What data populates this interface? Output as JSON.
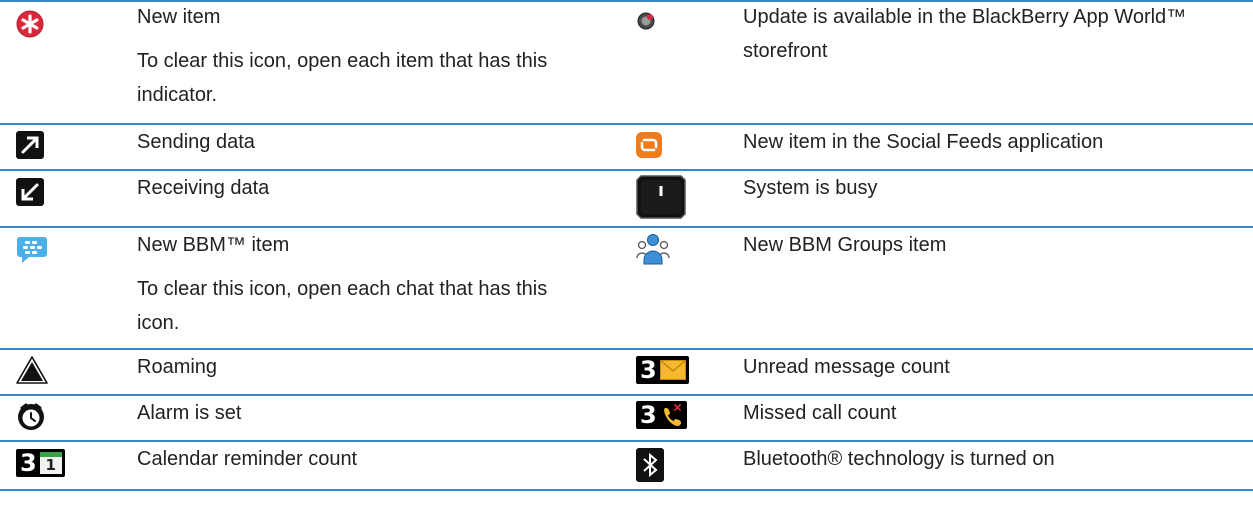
{
  "rows": [
    {
      "left": {
        "icon": "new-item-icon",
        "label": "New item",
        "note": "To clear this icon, open each item that has this indicator."
      },
      "right": {
        "icon": "app-world-update-icon",
        "label": "Update is available in the BlackBerry App World™ storefront"
      }
    },
    {
      "left": {
        "icon": "sending-data-icon",
        "label": "Sending data"
      },
      "right": {
        "icon": "social-feeds-icon",
        "label": "New item in the Social Feeds application"
      }
    },
    {
      "left": {
        "icon": "receiving-data-icon",
        "label": "Receiving data"
      },
      "right": {
        "icon": "system-busy-icon",
        "label": "System is busy"
      }
    },
    {
      "left": {
        "icon": "bbm-icon",
        "label": "New BBM™ item",
        "note": "To clear this icon, open each chat that has this icon."
      },
      "right": {
        "icon": "bbm-groups-icon",
        "label": "New BBM Groups item"
      }
    },
    {
      "left": {
        "icon": "roaming-icon",
        "label": "Roaming"
      },
      "right": {
        "icon": "unread-message-count-icon",
        "label": "Unread message count",
        "count": "3"
      }
    },
    {
      "left": {
        "icon": "alarm-icon",
        "label": "Alarm is set"
      },
      "right": {
        "icon": "missed-call-count-icon",
        "label": "Missed call count",
        "count": "3"
      }
    },
    {
      "left": {
        "icon": "calendar-reminder-count-icon",
        "label": "Calendar reminder count",
        "count": "3",
        "day": "1"
      },
      "right": {
        "icon": "bluetooth-icon",
        "label": "Bluetooth® technology is turned on"
      }
    }
  ],
  "colors": {
    "rule": "#3a87c8",
    "text": "#222222"
  }
}
